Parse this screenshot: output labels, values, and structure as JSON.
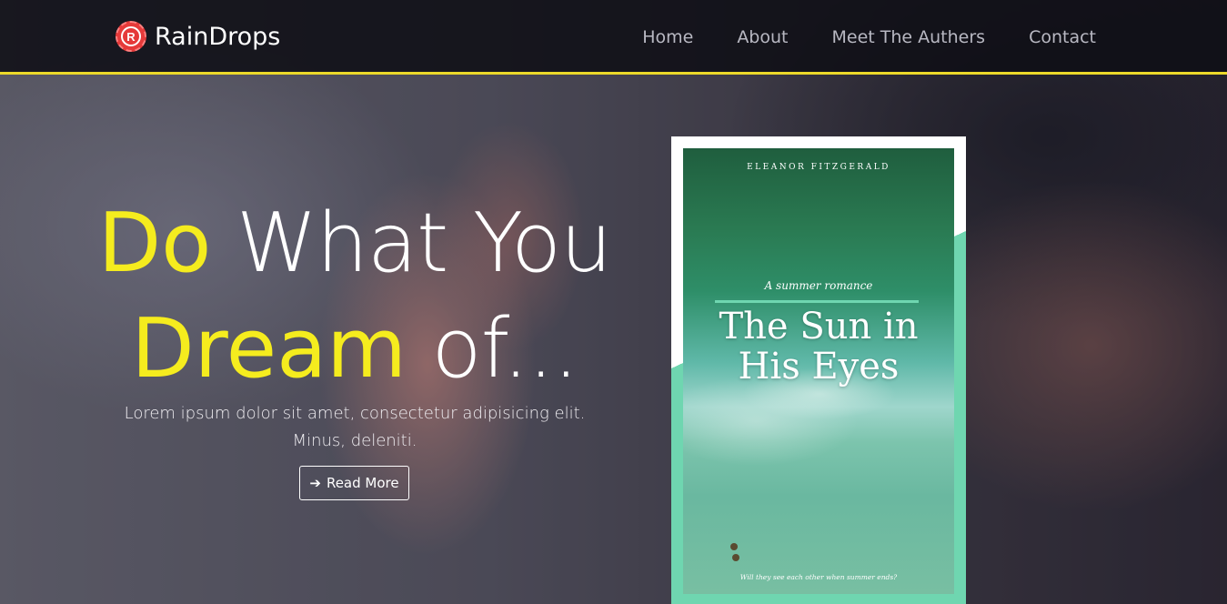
{
  "navbar": {
    "brand": "RainDrops",
    "brand_logo_letter": "R",
    "links": [
      "Home",
      "About",
      "Meet The Authers",
      "Contact"
    ]
  },
  "hero": {
    "headline_word1": "Do",
    "headline_word2": " What You",
    "headline_word3": "Dream",
    "headline_word4": " of...",
    "lead": "Lorem ipsum dolor sit amet, consectetur adipisicing elit. Minus, deleniti.",
    "button_label": "Read More",
    "button_icon": "arrow-right-icon"
  },
  "book": {
    "author": "ELEANOR FITZGERALD",
    "tagline": "A summer romance",
    "title_line1": "The Sun in",
    "title_line2": "His Eyes",
    "footer": "Will they see each other when summer ends?"
  },
  "colors": {
    "accent_yellow": "#f5ec1e",
    "nav_border": "#ecd92a",
    "book_accent": "#6fd6b0"
  }
}
